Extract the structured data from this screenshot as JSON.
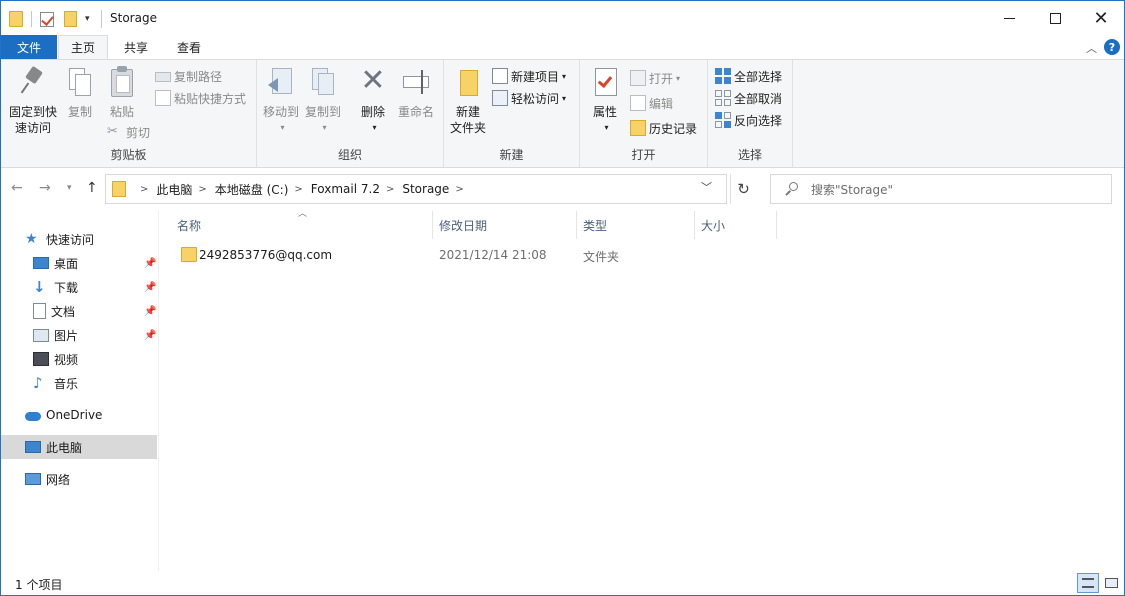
{
  "window": {
    "title": "Storage",
    "minimize_label": "",
    "maximize_label": "",
    "close_label": "✕"
  },
  "ribbon_tabs": {
    "file": "文件",
    "home": "主页",
    "share": "共享",
    "view": "查看"
  },
  "ribbon": {
    "clipboard": {
      "label": "剪贴板",
      "pin": "固定到快速访问",
      "pin_line1": "固定到快",
      "pin_line2": "速访问",
      "copy": "复制",
      "paste": "粘贴",
      "copy_path": "复制路径",
      "paste_shortcut": "粘贴快捷方式",
      "cut": "剪切"
    },
    "organize": {
      "label": "组织",
      "move_to": "移动到",
      "copy_to": "复制到",
      "delete": "删除",
      "rename": "重命名"
    },
    "new": {
      "label": "新建",
      "new_folder_line1": "新建",
      "new_folder_line2": "文件夹",
      "new_item": "新建项目",
      "easy_access": "轻松访问"
    },
    "open": {
      "label": "打开",
      "properties": "属性",
      "open": "打开",
      "edit": "编辑",
      "history": "历史记录"
    },
    "select": {
      "label": "选择",
      "select_all": "全部选择",
      "select_none": "全部取消",
      "invert": "反向选择"
    }
  },
  "address": {
    "crumbs": [
      "此电脑",
      "本地磁盘 (C:)",
      "Foxmail 7.2",
      "Storage"
    ],
    "search_placeholder": "搜索\"Storage\""
  },
  "sidebar": {
    "quick_access": "快速访问",
    "items": [
      {
        "label": "桌面",
        "pinned": true
      },
      {
        "label": "下载",
        "pinned": true
      },
      {
        "label": "文档",
        "pinned": true
      },
      {
        "label": "图片",
        "pinned": true
      },
      {
        "label": "视频",
        "pinned": false
      },
      {
        "label": "音乐",
        "pinned": false
      }
    ],
    "onedrive": "OneDrive",
    "this_pc": "此电脑",
    "network": "网络"
  },
  "columns": {
    "name": "名称",
    "date": "修改日期",
    "type": "类型",
    "size": "大小"
  },
  "files": [
    {
      "name": "2492853776@qq.com",
      "date": "2021/12/14 21:08",
      "type": "文件夹",
      "size": ""
    }
  ],
  "status": {
    "count": "1 个项目"
  },
  "colors": {
    "accent": "#1b6ec2",
    "folder": "#f7d267",
    "selected_nav": "#d9d9d9"
  }
}
